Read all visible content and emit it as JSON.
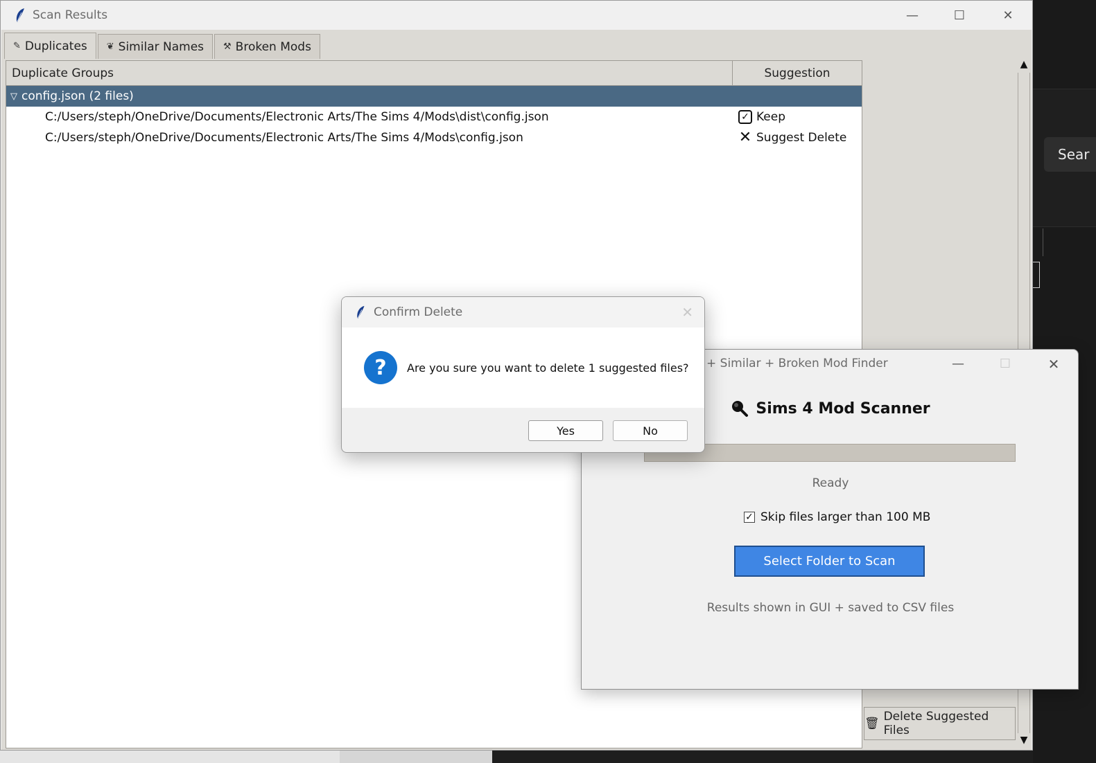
{
  "main_window": {
    "title": "Scan Results",
    "tabs": [
      {
        "label": "Duplicates",
        "icon": "feather-icon",
        "active": true
      },
      {
        "label": "Similar Names",
        "icon": "leaf-icon",
        "active": false
      },
      {
        "label": "Broken Mods",
        "icon": "tools-icon",
        "active": false
      }
    ],
    "tree": {
      "columns": [
        "Duplicate Groups",
        "Suggestion"
      ],
      "group": {
        "label": "config.json (2 files)",
        "expanded": true
      },
      "rows": [
        {
          "path": "C:/Users/steph/OneDrive/Documents/Electronic Arts/The Sims 4/Mods\\dist\\config.json",
          "suggestion": "Keep",
          "icon": "checkbox-icon"
        },
        {
          "path": "C:/Users/steph/OneDrive/Documents/Electronic Arts/The Sims 4/Mods\\config.json",
          "suggestion": "Suggest Delete",
          "icon": "x-icon"
        }
      ]
    },
    "delete_button": "Delete Suggested Files"
  },
  "scanner_window": {
    "title": "+ Similar + Broken Mod Finder",
    "heading": "Sims 4 Mod Scanner",
    "progress": 0,
    "status": "Ready",
    "skip_label": "Skip files larger than 100 MB",
    "skip_checked": true,
    "select_button": "Select Folder to Scan",
    "footnote": "Results shown in GUI + saved to CSV files"
  },
  "dialog": {
    "title": "Confirm Delete",
    "message": "Are you sure you want to delete 1 suggested files?",
    "yes_label": "Yes",
    "no_label": "No"
  },
  "background_app": {
    "search_label": "Sear"
  },
  "colors": {
    "selection": "#4a6984",
    "primary_button": "#3f86e4",
    "question_icon": "#1573cf"
  }
}
